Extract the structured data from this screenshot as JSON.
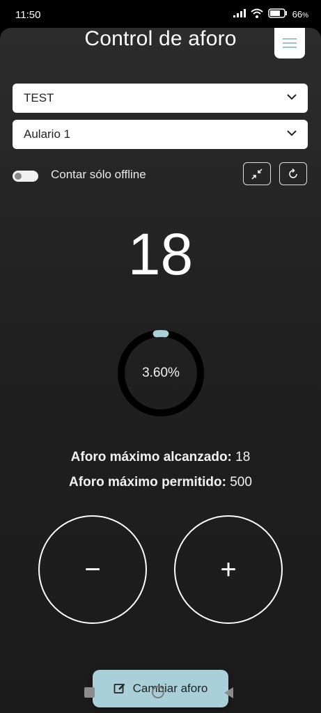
{
  "status_bar": {
    "time": "11:50",
    "battery": "66",
    "battery_unit": "%"
  },
  "header": {
    "title": "Control de aforo"
  },
  "selects": {
    "organization": {
      "value": "TEST"
    },
    "room": {
      "value": "Aulario 1"
    }
  },
  "offline_toggle": {
    "label": "Contar sólo offline",
    "enabled": false
  },
  "counter": {
    "value": "18"
  },
  "occupancy": {
    "percent_label": "3.60%",
    "fraction": 0.036
  },
  "stats": {
    "max_reached_label": "Aforo máximo alcanzado:",
    "max_reached_value": "18",
    "max_allowed_label": "Aforo máximo permitido:",
    "max_allowed_value": "500"
  },
  "buttons": {
    "decrement": "−",
    "increment": "+",
    "change_capacity": "Cambiar aforo"
  },
  "colors": {
    "accent": "#a9d0d8",
    "background": "#222222"
  }
}
